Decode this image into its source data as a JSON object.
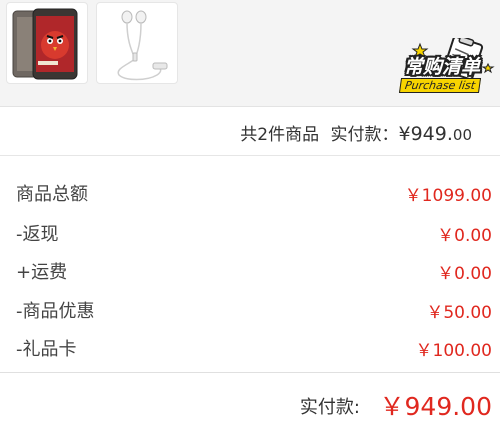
{
  "products": [
    {
      "name": "phone-thumbnail"
    },
    {
      "name": "earphone-thumbnail"
    }
  ],
  "badge": {
    "title": "常购清单",
    "subtitle": "Purchase list"
  },
  "summary": {
    "count_text": "共2件商品",
    "pay_label": "实付款：",
    "amount_int": "¥949.",
    "amount_dec": "00"
  },
  "fees": [
    {
      "label": "商品总额",
      "value": "￥1099.00"
    },
    {
      "label": "-返现",
      "value": "￥0.00"
    },
    {
      "label": "+运费",
      "value": "￥0.00"
    },
    {
      "label": "-商品优惠",
      "value": "￥50.00"
    },
    {
      "label": "-礼品卡",
      "value": "￥100.00"
    }
  ],
  "total": {
    "label": "实付款:",
    "value": "￥949.00"
  },
  "colors": {
    "price_red": "#e0281f",
    "badge_yellow": "#f7d400",
    "strip_bg": "#f4f4f4"
  }
}
